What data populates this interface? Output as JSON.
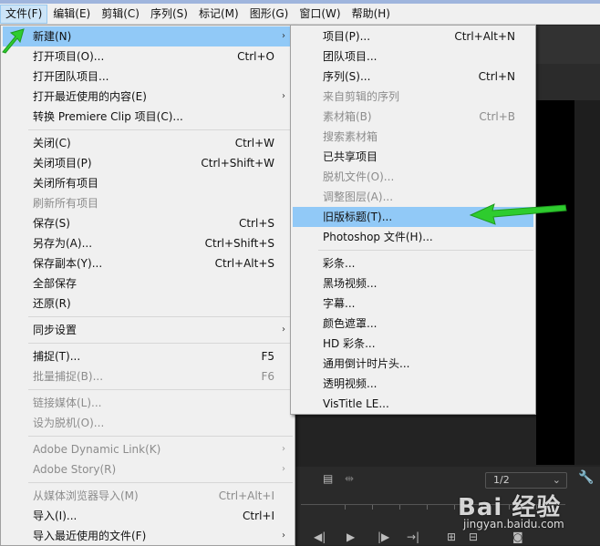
{
  "menubar": [
    "文件(F)",
    "编辑(E)",
    "剪辑(C)",
    "序列(S)",
    "标记(M)",
    "图形(G)",
    "窗口(W)",
    "帮助(H)"
  ],
  "file_menu": [
    {
      "label": "新建(N)",
      "shortcut": "",
      "submenu": true,
      "disabled": false,
      "highlight": true
    },
    {
      "label": "打开项目(O)...",
      "shortcut": "Ctrl+O",
      "submenu": false,
      "disabled": false
    },
    {
      "label": "打开团队项目...",
      "shortcut": "",
      "submenu": false,
      "disabled": false
    },
    {
      "label": "打开最近使用的内容(E)",
      "shortcut": "",
      "submenu": true,
      "disabled": false
    },
    {
      "label": "转换 Premiere Clip 项目(C)...",
      "shortcut": "",
      "submenu": false,
      "disabled": false,
      "sep_after": true
    },
    {
      "label": "关闭(C)",
      "shortcut": "Ctrl+W",
      "submenu": false,
      "disabled": false
    },
    {
      "label": "关闭项目(P)",
      "shortcut": "Ctrl+Shift+W",
      "submenu": false,
      "disabled": false
    },
    {
      "label": "关闭所有项目",
      "shortcut": "",
      "submenu": false,
      "disabled": false
    },
    {
      "label": "刷新所有项目",
      "shortcut": "",
      "submenu": false,
      "disabled": true
    },
    {
      "label": "保存(S)",
      "shortcut": "Ctrl+S",
      "submenu": false,
      "disabled": false
    },
    {
      "label": "另存为(A)...",
      "shortcut": "Ctrl+Shift+S",
      "submenu": false,
      "disabled": false
    },
    {
      "label": "保存副本(Y)...",
      "shortcut": "Ctrl+Alt+S",
      "submenu": false,
      "disabled": false
    },
    {
      "label": "全部保存",
      "shortcut": "",
      "submenu": false,
      "disabled": false
    },
    {
      "label": "还原(R)",
      "shortcut": "",
      "submenu": false,
      "disabled": false,
      "sep_after": true
    },
    {
      "label": "同步设置",
      "shortcut": "",
      "submenu": true,
      "disabled": false,
      "sep_after": true
    },
    {
      "label": "捕捉(T)...",
      "shortcut": "F5",
      "submenu": false,
      "disabled": false
    },
    {
      "label": "批量捕捉(B)...",
      "shortcut": "F6",
      "submenu": false,
      "disabled": true,
      "sep_after": true
    },
    {
      "label": "链接媒体(L)...",
      "shortcut": "",
      "submenu": false,
      "disabled": true
    },
    {
      "label": "设为脱机(O)...",
      "shortcut": "",
      "submenu": false,
      "disabled": true,
      "sep_after": true
    },
    {
      "label": "Adobe Dynamic Link(K)",
      "shortcut": "",
      "submenu": true,
      "disabled": true
    },
    {
      "label": "Adobe Story(R)",
      "shortcut": "",
      "submenu": true,
      "disabled": true,
      "sep_after": true
    },
    {
      "label": "从媒体浏览器导入(M)",
      "shortcut": "Ctrl+Alt+I",
      "submenu": false,
      "disabled": true
    },
    {
      "label": "导入(I)...",
      "shortcut": "Ctrl+I",
      "submenu": false,
      "disabled": false
    },
    {
      "label": "导入最近使用的文件(F)",
      "shortcut": "",
      "submenu": true,
      "disabled": false
    }
  ],
  "new_submenu": [
    {
      "label": "项目(P)...",
      "shortcut": "Ctrl+Alt+N",
      "disabled": false
    },
    {
      "label": "团队项目...",
      "shortcut": "",
      "disabled": false
    },
    {
      "label": "序列(S)...",
      "shortcut": "Ctrl+N",
      "disabled": false
    },
    {
      "label": "来自剪辑的序列",
      "shortcut": "",
      "disabled": true
    },
    {
      "label": "素材箱(B)",
      "shortcut": "Ctrl+B",
      "disabled": true
    },
    {
      "label": "搜索素材箱",
      "shortcut": "",
      "disabled": true
    },
    {
      "label": "已共享项目",
      "shortcut": "",
      "disabled": false
    },
    {
      "label": "脱机文件(O)...",
      "shortcut": "",
      "disabled": true
    },
    {
      "label": "调整图层(A)...",
      "shortcut": "",
      "disabled": true
    },
    {
      "label": "旧版标题(T)...",
      "shortcut": "",
      "disabled": false,
      "highlight": true
    },
    {
      "label": "Photoshop 文件(H)...",
      "shortcut": "",
      "disabled": false,
      "sep_after": true
    },
    {
      "label": "彩条...",
      "shortcut": "",
      "disabled": false
    },
    {
      "label": "黑场视频...",
      "shortcut": "",
      "disabled": false
    },
    {
      "label": "字幕...",
      "shortcut": "",
      "disabled": false
    },
    {
      "label": "颜色遮罩...",
      "shortcut": "",
      "disabled": false
    },
    {
      "label": "HD 彩条...",
      "shortcut": "",
      "disabled": false
    },
    {
      "label": "通用倒计时片头...",
      "shortcut": "",
      "disabled": false
    },
    {
      "label": "透明视频...",
      "shortcut": "",
      "disabled": false
    },
    {
      "label": "VisTitle LE...",
      "shortcut": "",
      "disabled": false
    }
  ],
  "program_monitor": {
    "zoom_value": "1/2"
  },
  "watermark": {
    "logo": "Bai 经验",
    "url": "jingyan.baidu.com"
  },
  "icons": {
    "submenu_arrow": "chevron-right-icon",
    "annotation": "green-arrow-icon",
    "wrench": "wrench-icon"
  },
  "colors": {
    "highlight": "#91c9f7",
    "annotation_arrow": "#2ecc2e",
    "menu_bg": "#f0f0f0"
  }
}
